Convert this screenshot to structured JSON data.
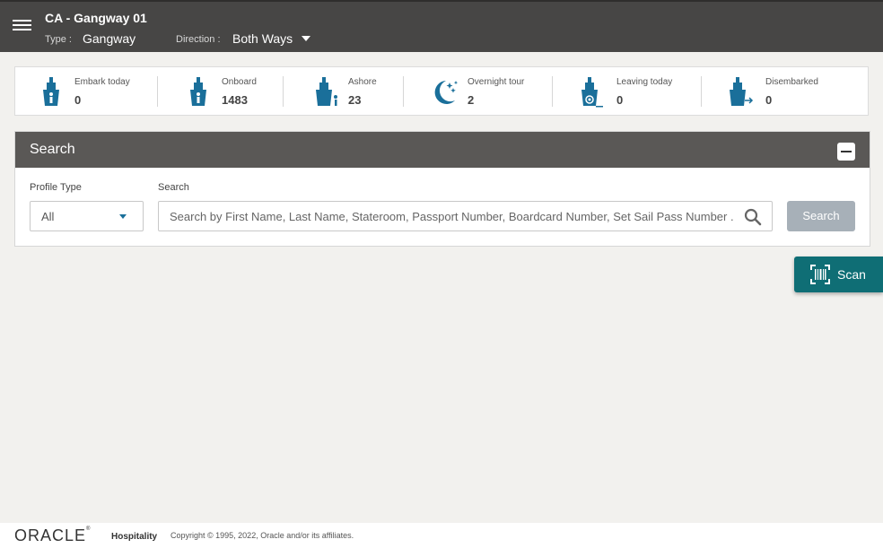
{
  "header": {
    "title": "CA - Gangway 01",
    "type_label": "Type :",
    "type_value": "Gangway",
    "direction_label": "Direction :",
    "direction_value": "Both Ways"
  },
  "stats": [
    {
      "label": "Embark today",
      "value": "0",
      "icon": "ship-person-icon"
    },
    {
      "label": "Onboard",
      "value": "1483",
      "icon": "ship-person-icon"
    },
    {
      "label": "Ashore",
      "value": "23",
      "icon": "ship-walking-person-icon"
    },
    {
      "label": "Overnight tour",
      "value": "2",
      "icon": "moon-stars-icon"
    },
    {
      "label": "Leaving today",
      "value": "0",
      "icon": "ship-target-icon"
    },
    {
      "label": "Disembarked",
      "value": "0",
      "icon": "ship-arrow-icon"
    }
  ],
  "search": {
    "title": "Search",
    "profile_type_label": "Profile Type",
    "profile_type_value": "All",
    "search_label": "Search",
    "placeholder": "Search by First Name, Last Name, Stateroom, Passport Number, Boardcard Number, Set Sail Pass Number ...",
    "button_label": "Search"
  },
  "scan": {
    "label": "Scan"
  },
  "footer": {
    "brand": "ORACLE",
    "product": "Hospitality",
    "copyright": "Copyright © 1995, 2022, Oracle and/or its affiliates."
  },
  "colors": {
    "header_bg": "#474645",
    "accent": "#1a6f9a",
    "scan_bg": "#0f6e75",
    "search_button_bg": "#a7b0b8"
  }
}
